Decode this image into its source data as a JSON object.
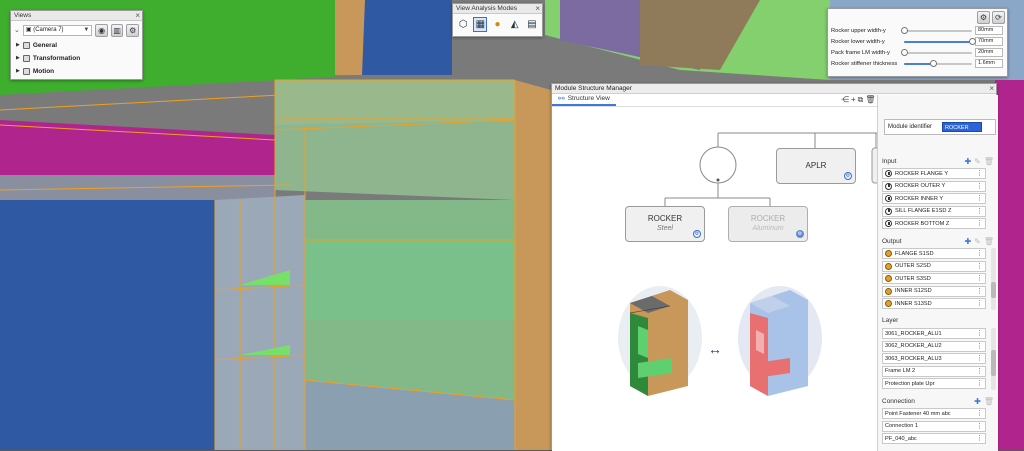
{
  "views": {
    "title": "Views",
    "camera": "(Camera 7)",
    "items": [
      {
        "label": "General"
      },
      {
        "label": "Transformation"
      },
      {
        "label": "Motion"
      }
    ]
  },
  "analysis": {
    "title": "View Analysis Modes"
  },
  "params": {
    "rows": [
      {
        "label": "Rocker upper width-y",
        "value": "80mm",
        "level": 0.0
      },
      {
        "label": "Rocker lower width-y",
        "value": "70mm",
        "level": 1.0
      },
      {
        "label": "Pack frame LM width-y",
        "value": "20mm",
        "level": 0.0
      },
      {
        "label": "Rocker stiffener thickness",
        "value": "1.6mm",
        "level": 0.42
      }
    ]
  },
  "msm": {
    "title": "Module Structure Manager",
    "tab": "Structure View",
    "nodes": {
      "aplr": "APLR",
      "rocker_steel": {
        "name": "ROCKER",
        "material": "Steel"
      },
      "rocker_alu": {
        "name": "ROCKER",
        "material": "Aluminum"
      }
    },
    "module_identifier_label": "Module identifier",
    "module_identifier_value": "ROCKER",
    "sections": {
      "input": "Input",
      "output": "Output",
      "layer": "Layer",
      "connection": "Connection"
    },
    "input": [
      "ROCKER FLANGE Y",
      "ROCKER OUTER Y",
      "ROCKER INNER Y",
      "SILL FLANGE E1SD Z",
      "ROCKER BOTTOM Z"
    ],
    "output": [
      "FLANGE S1SD",
      "OUTER S2SD",
      "OUTER S3SD",
      "INNER S12SD",
      "INNER S13SD"
    ],
    "layer": [
      "3061_ROCKER_ALU1",
      "3062_ROCKER_ALU2",
      "3063_ROCKER_ALU3",
      "Frame LM 2",
      "Protection plate Upr"
    ],
    "connection": [
      "Point Fastener 40 mm abc",
      "Connection 1",
      "PF_040_abc"
    ]
  }
}
